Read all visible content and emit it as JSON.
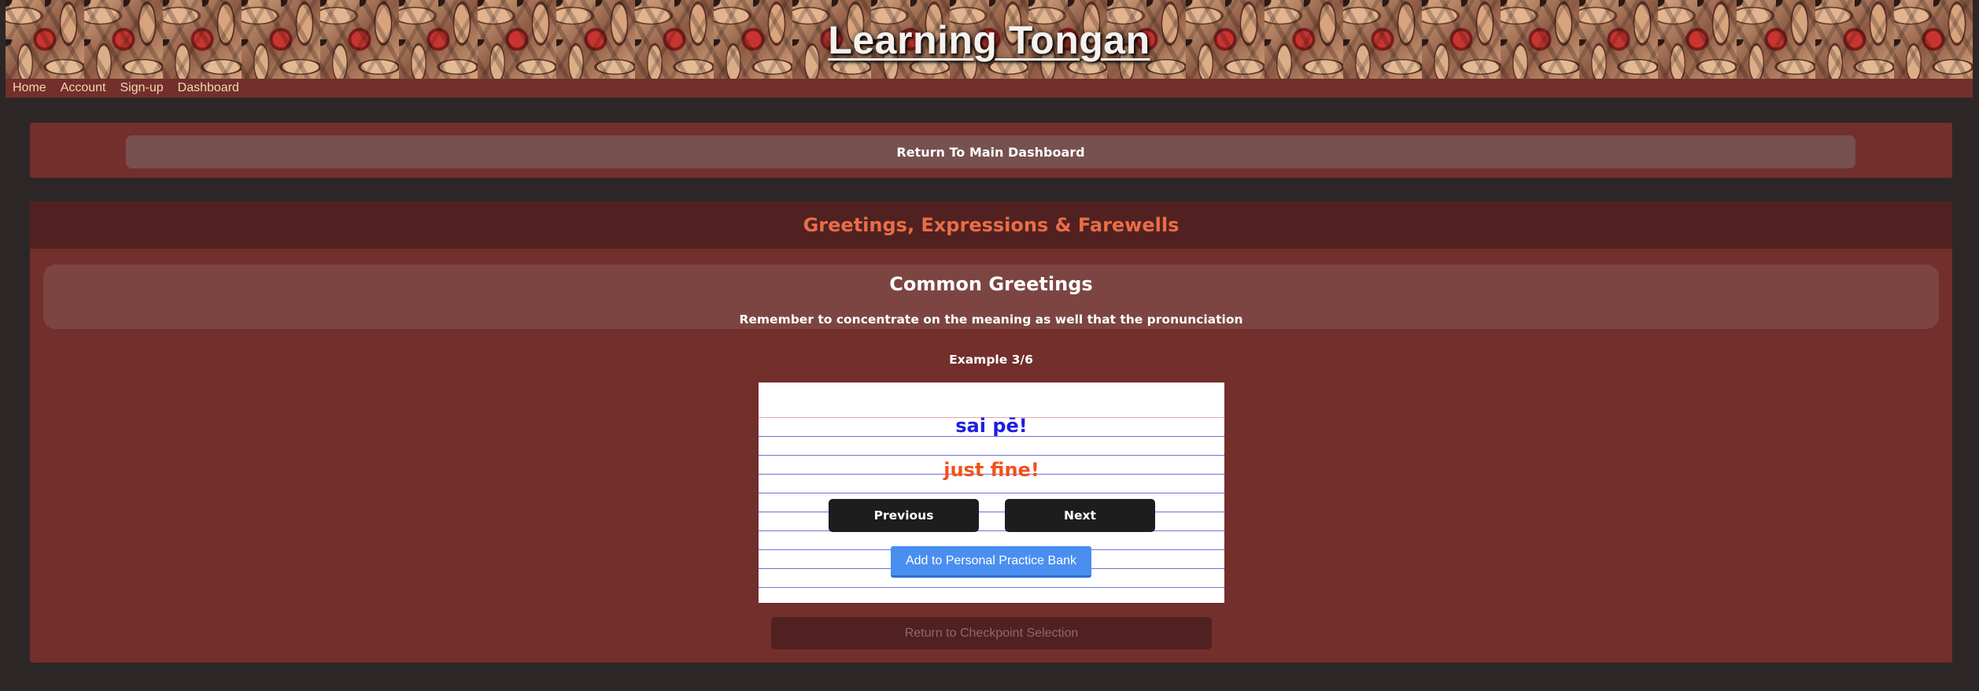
{
  "site": {
    "title": "Learning Tongan"
  },
  "nav": {
    "items": [
      {
        "label": "Home"
      },
      {
        "label": "Account"
      },
      {
        "label": "Sign-up"
      },
      {
        "label": "Dashboard"
      }
    ]
  },
  "return_panel": {
    "button_label": "Return To Main Dashboard"
  },
  "lesson": {
    "title": "Greetings, Expressions & Farewells",
    "subsection_title": "Common Greetings",
    "instruction": "Remember to concentrate on the meaning as well that the pronunciation",
    "example_counter": "Example 3/6",
    "card": {
      "tongan": "sai pē!",
      "english": "just fine!",
      "previous_label": "Previous",
      "next_label": "Next",
      "practice_label": "Add to Personal Practice Bank"
    },
    "checkpoint_label": "Return to Checkpoint Selection"
  },
  "colors": {
    "background": "#2c2726",
    "panel": "#722f2c",
    "header": "#502120",
    "lesson_title": "#e96d46",
    "tongan_text": "#1e1ee0",
    "english_text": "#f0521a",
    "practice_button": "#4a8ef0"
  }
}
